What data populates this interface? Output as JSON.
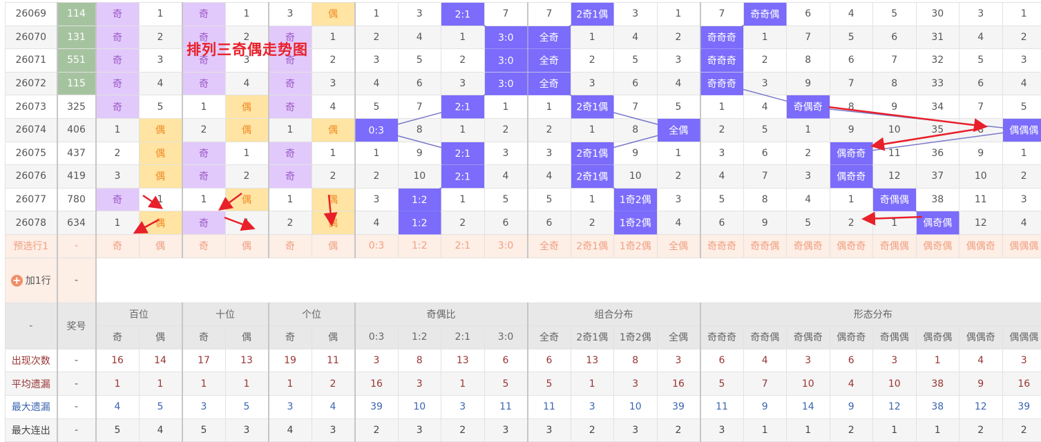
{
  "title": "排列三奇偶走势图",
  "groups": [
    {
      "label": "百位",
      "cols": [
        "奇",
        "偶"
      ]
    },
    {
      "label": "十位",
      "cols": [
        "奇",
        "偶"
      ]
    },
    {
      "label": "个位",
      "cols": [
        "奇",
        "偶"
      ]
    },
    {
      "label": "奇偶比",
      "cols": [
        "0:3",
        "1:2",
        "2:1",
        "3:0"
      ]
    },
    {
      "label": "组合分布",
      "cols": [
        "全奇",
        "2奇1偶",
        "1奇2偶",
        "全偶"
      ]
    },
    {
      "label": "形态分布",
      "cols": [
        "奇奇奇",
        "奇奇偶",
        "奇偶奇",
        "偶奇奇",
        "奇偶偶",
        "偶奇偶",
        "偶偶奇",
        "偶偶偶"
      ]
    }
  ],
  "header": {
    "corner": "-",
    "number": "奖号"
  },
  "rows": [
    {
      "issue": "26069",
      "number": "114",
      "hl": true,
      "cells": [
        "奇",
        "1",
        "奇",
        "1",
        "3",
        "偶",
        "1",
        "3",
        "2:1",
        "7",
        "7",
        "2奇1偶",
        "3",
        "1",
        "7",
        "奇奇偶",
        "6",
        "4",
        "5",
        "30",
        "3",
        "1"
      ]
    },
    {
      "issue": "26070",
      "number": "131",
      "hl": true,
      "cells": [
        "奇",
        "2",
        "奇",
        "2",
        "奇",
        "1",
        "2",
        "4",
        "1",
        "3:0",
        "全奇",
        "1",
        "4",
        "2",
        "奇奇奇",
        "1",
        "7",
        "5",
        "6",
        "31",
        "4",
        "2"
      ]
    },
    {
      "issue": "26071",
      "number": "551",
      "hl": true,
      "cells": [
        "奇",
        "3",
        "奇",
        "3",
        "奇",
        "2",
        "3",
        "5",
        "2",
        "3:0",
        "全奇",
        "2",
        "5",
        "3",
        "奇奇奇",
        "2",
        "8",
        "6",
        "7",
        "32",
        "5",
        "3"
      ]
    },
    {
      "issue": "26072",
      "number": "115",
      "hl": true,
      "cells": [
        "奇",
        "4",
        "奇",
        "4",
        "奇",
        "3",
        "4",
        "6",
        "3",
        "3:0",
        "全奇",
        "3",
        "6",
        "4",
        "奇奇奇",
        "3",
        "9",
        "7",
        "8",
        "33",
        "6",
        "4"
      ]
    },
    {
      "issue": "26073",
      "number": "325",
      "hl": false,
      "cells": [
        "奇",
        "5",
        "1",
        "偶",
        "奇",
        "4",
        "5",
        "7",
        "2:1",
        "1",
        "1",
        "2奇1偶",
        "7",
        "5",
        "1",
        "4",
        "奇偶奇",
        "8",
        "9",
        "34",
        "7",
        "5"
      ]
    },
    {
      "issue": "26074",
      "number": "406",
      "hl": false,
      "cells": [
        "1",
        "偶",
        "2",
        "偶",
        "1",
        "偶",
        "0:3",
        "8",
        "1",
        "2",
        "2",
        "1",
        "8",
        "全偶",
        "2",
        "5",
        "1",
        "9",
        "10",
        "35",
        "8",
        "偶偶偶"
      ]
    },
    {
      "issue": "26075",
      "number": "437",
      "hl": false,
      "cells": [
        "2",
        "偶",
        "奇",
        "1",
        "奇",
        "1",
        "1",
        "9",
        "2:1",
        "3",
        "3",
        "2奇1偶",
        "9",
        "1",
        "3",
        "6",
        "2",
        "偶奇奇",
        "11",
        "36",
        "9",
        "1"
      ]
    },
    {
      "issue": "26076",
      "number": "419",
      "hl": false,
      "cells": [
        "3",
        "偶",
        "奇",
        "2",
        "奇",
        "2",
        "2",
        "10",
        "2:1",
        "4",
        "4",
        "2奇1偶",
        "10",
        "2",
        "4",
        "7",
        "3",
        "偶奇奇",
        "12",
        "37",
        "10",
        "2"
      ]
    },
    {
      "issue": "26077",
      "number": "780",
      "hl": false,
      "cells": [
        "奇",
        "1",
        "1",
        "偶",
        "1",
        "偶",
        "3",
        "1:2",
        "1",
        "5",
        "5",
        "1",
        "1奇2偶",
        "3",
        "5",
        "8",
        "4",
        "1",
        "奇偶偶",
        "38",
        "11",
        "3"
      ]
    },
    {
      "issue": "26078",
      "number": "634",
      "hl": false,
      "cells": [
        "1",
        "偶",
        "奇",
        "1",
        "2",
        "偶",
        "4",
        "1:2",
        "2",
        "6",
        "6",
        "2",
        "1奇2偶",
        "4",
        "6",
        "9",
        "5",
        "2",
        "1",
        "偶奇偶",
        "12",
        "4"
      ]
    }
  ],
  "preselect": {
    "label": "预选行1",
    "dash": "-"
  },
  "add_row": {
    "label": "加1行",
    "dash": "-"
  },
  "stats": [
    {
      "label": "出现次数",
      "dash": "-",
      "color": "red",
      "values": [
        "16",
        "14",
        "17",
        "13",
        "19",
        "11",
        "3",
        "8",
        "13",
        "6",
        "6",
        "13",
        "8",
        "3",
        "6",
        "4",
        "3",
        "6",
        "3",
        "1",
        "4",
        "3"
      ]
    },
    {
      "label": "平均遗漏",
      "dash": "-",
      "color": "red",
      "values": [
        "1",
        "1",
        "1",
        "1",
        "1",
        "2",
        "16",
        "3",
        "1",
        "5",
        "5",
        "1",
        "3",
        "16",
        "5",
        "7",
        "10",
        "4",
        "10",
        "38",
        "9",
        "16"
      ]
    },
    {
      "label": "最大遗漏",
      "dash": "-",
      "color": "blue",
      "values": [
        "4",
        "5",
        "3",
        "5",
        "3",
        "4",
        "39",
        "10",
        "3",
        "11",
        "11",
        "3",
        "10",
        "39",
        "11",
        "9",
        "14",
        "9",
        "12",
        "38",
        "12",
        "39"
      ]
    },
    {
      "label": "最大连出",
      "dash": "-",
      "color": "dark",
      "values": [
        "5",
        "4",
        "5",
        "3",
        "4",
        "3",
        "2",
        "3",
        "2",
        "3",
        "3",
        "2",
        "3",
        "2",
        "3",
        "1",
        "1",
        "2",
        "1",
        "1",
        "2",
        "2"
      ]
    }
  ],
  "colors": {
    "hit": "#7b6cfb",
    "odd": "#e2c9fb",
    "even": "#ffe4a3",
    "number_highlight": "#a6c3a0",
    "line": "#7a78c8",
    "arrow": "#e8202a"
  }
}
